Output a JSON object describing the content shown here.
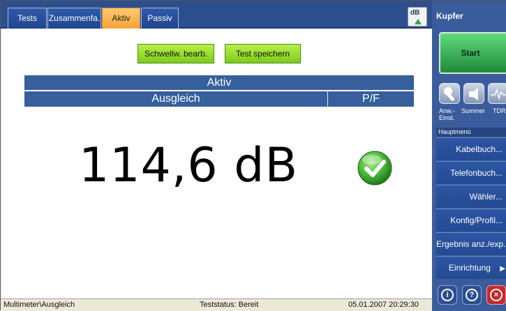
{
  "tabs": [
    {
      "label": "Tests"
    },
    {
      "label": "Zusammenfa."
    },
    {
      "label": "Aktiv",
      "active": true
    },
    {
      "label": "Passiv"
    }
  ],
  "toolbar_icon": {
    "label": "dB",
    "icon": "db-level-icon"
  },
  "buttons": {
    "edit_threshold": "Schwellw. bearb.",
    "save_test": "Test speichern"
  },
  "table": {
    "title": "Aktiv",
    "col_measurement": "Ausgleich",
    "col_pf": "P/F"
  },
  "result": {
    "value": "114,6 dB",
    "status_icon": "pass-check-icon",
    "status": "pass"
  },
  "statusbar": {
    "path": "Multimeter\\Ausgleich",
    "test_status": "Teststatus: Bereit",
    "datetime": "05.01.2007 20:29:30"
  },
  "right_panel": {
    "title": "Kupfer",
    "start_label": "Start",
    "tools": [
      {
        "label_line1": "Anw.-",
        "label_line2": "Einst.",
        "icon": "wrench-icon"
      },
      {
        "label_line1": "Summer",
        "label_line2": "",
        "icon": "speaker-icon"
      },
      {
        "label_line1": "TDR",
        "label_line2": "",
        "icon": "tdr-waveform-icon"
      }
    ],
    "menu_title": "Hauptmenü",
    "menu_items": [
      {
        "label": "Kabelbuch..."
      },
      {
        "label": "Telefonbuch..."
      },
      {
        "label": "Wähler..."
      },
      {
        "label": "Konfig/Profil..."
      },
      {
        "label": "Ergebnis anz./exp..."
      },
      {
        "label": "Einrichtung",
        "arrow": "▶"
      }
    ],
    "bottom_icons": [
      "info-icon",
      "help-icon",
      "close-icon"
    ]
  },
  "colors": {
    "tab_bar": "#2e4f8f",
    "tab_active": "#f4a437",
    "header_blue": "#365f9b",
    "button_green": "#7ccb1d",
    "panel_blue": "#3a5c9c",
    "pass_green": "#3bb34a",
    "close_red": "#c8282b"
  }
}
